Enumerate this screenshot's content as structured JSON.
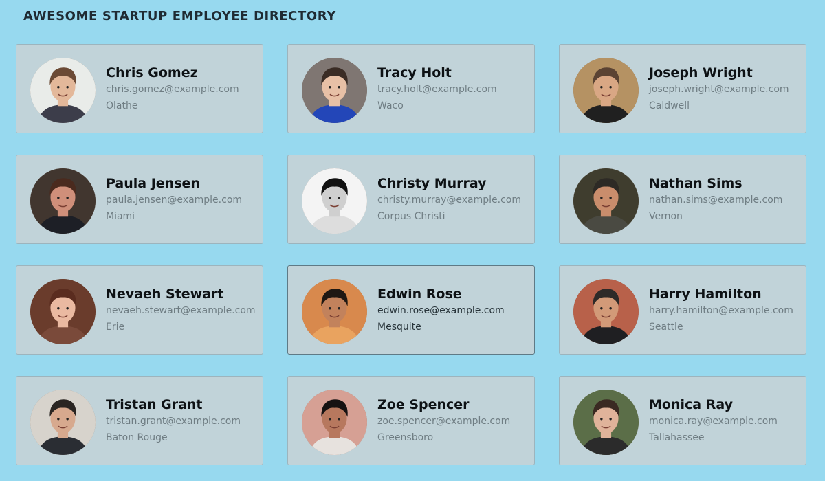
{
  "header": {
    "title": "AWESOME STARTUP EMPLOYEE DIRECTORY"
  },
  "employees": [
    {
      "name": "Chris Gomez",
      "email": "chris.gomez@example.com",
      "city": "Olathe",
      "bg": "#e9ece9",
      "skin": "#e3b89a",
      "hair": "#6b4a35",
      "shirt": "#3c3d4a",
      "active": false
    },
    {
      "name": "Tracy Holt",
      "email": "tracy.holt@example.com",
      "city": "Waco",
      "bg": "#7f7672",
      "skin": "#e7c0a6",
      "hair": "#3a2c25",
      "shirt": "#2346b8",
      "active": false
    },
    {
      "name": "Joseph Wright",
      "email": "joseph.wright@example.com",
      "city": "Caldwell",
      "bg": "#b59263",
      "skin": "#d9a784",
      "hair": "#5b4333",
      "shirt": "#202020",
      "active": false
    },
    {
      "name": "Paula Jensen",
      "email": "paula.jensen@example.com",
      "city": "Miami",
      "bg": "#41362f",
      "skin": "#cf8f7a",
      "hair": "#4a2a1e",
      "shirt": "#1d1f26",
      "active": false
    },
    {
      "name": "Christy Murray",
      "email": "christy.murray@example.com",
      "city": "Corpus Christi",
      "bg": "#f4f4f4",
      "skin": "#cfcfcf",
      "hair": "#111111",
      "shirt": "#dddddd",
      "active": false
    },
    {
      "name": "Nathan Sims",
      "email": "nathan.sims@example.com",
      "city": "Vernon",
      "bg": "#3f3d2e",
      "skin": "#c98d6c",
      "hair": "#2d2a25",
      "shirt": "#4a4a42",
      "active": false
    },
    {
      "name": "Nevaeh Stewart",
      "email": "nevaeh.stewart@example.com",
      "city": "Erie",
      "bg": "#6a3c2c",
      "skin": "#eab9a1",
      "hair": "#5a2c1f",
      "shirt": "#7a4a3a",
      "active": false
    },
    {
      "name": "Edwin Rose",
      "email": "edwin.rose@example.com",
      "city": "Mesquite",
      "bg": "#d8894d",
      "skin": "#c2825c",
      "hair": "#1f1813",
      "shirt": "#e9a35f",
      "active": true
    },
    {
      "name": "Harry Hamilton",
      "email": "harry.hamilton@example.com",
      "city": "Seattle",
      "bg": "#b8614a",
      "skin": "#d29a78",
      "hair": "#2e2a28",
      "shirt": "#1f1f22",
      "active": false
    },
    {
      "name": "Tristan Grant",
      "email": "tristan.grant@example.com",
      "city": "Baton Rouge",
      "bg": "#d7d3cc",
      "skin": "#d7a98e",
      "hair": "#2a2522",
      "shirt": "#2a2d33",
      "active": false
    },
    {
      "name": "Zoe Spencer",
      "email": "zoe.spencer@example.com",
      "city": "Greensboro",
      "bg": "#d6a094",
      "skin": "#b7785e",
      "hair": "#161212",
      "shirt": "#e7e2de",
      "active": false
    },
    {
      "name": "Monica Ray",
      "email": "monica.ray@example.com",
      "city": "Tallahassee",
      "bg": "#5b6e48",
      "skin": "#e0b39a",
      "hair": "#3a2a22",
      "shirt": "#2b2b2b",
      "active": false
    }
  ]
}
